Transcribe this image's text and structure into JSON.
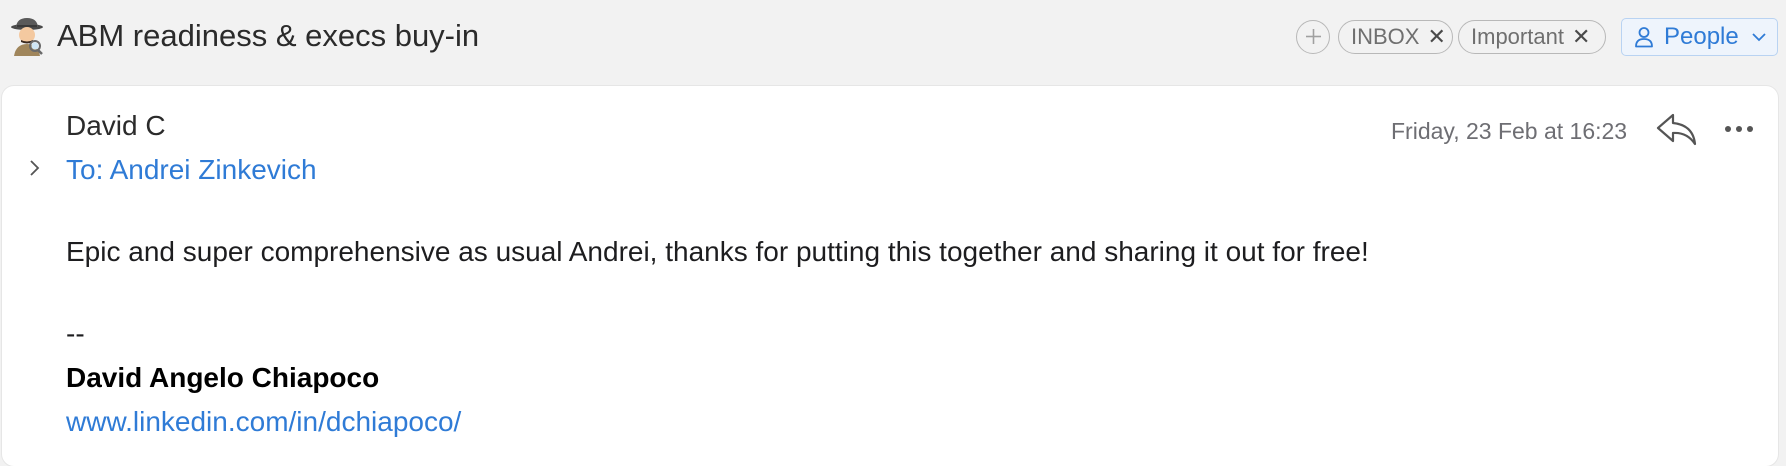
{
  "thread": {
    "subject": "ABM readiness & execs buy-in",
    "subject_icon": "detective-emoji-icon"
  },
  "labels": {
    "add_icon": "plus-icon",
    "items": [
      {
        "label": "INBOX",
        "remove": "✕"
      },
      {
        "label": "Important",
        "remove": "✕"
      }
    ]
  },
  "people_button": {
    "label": "People",
    "icon": "person-icon",
    "dropdown_icon": "chevron-down-icon"
  },
  "message": {
    "sender": "David C",
    "to": "To: Andrei Zinkevich",
    "date": "Friday, 23 Feb at 16:23",
    "body": "Epic and super comprehensive as usual Andrei, thanks for putting this together and sharing it out for free!",
    "signature": {
      "dash": "--",
      "name": "David Angelo Chiapoco",
      "link": "www.linkedin.com/in/dchiapoco/"
    }
  },
  "colors": {
    "accent": "#2f7bd6",
    "background": "#f2f2f2",
    "card": "#ffffff"
  }
}
